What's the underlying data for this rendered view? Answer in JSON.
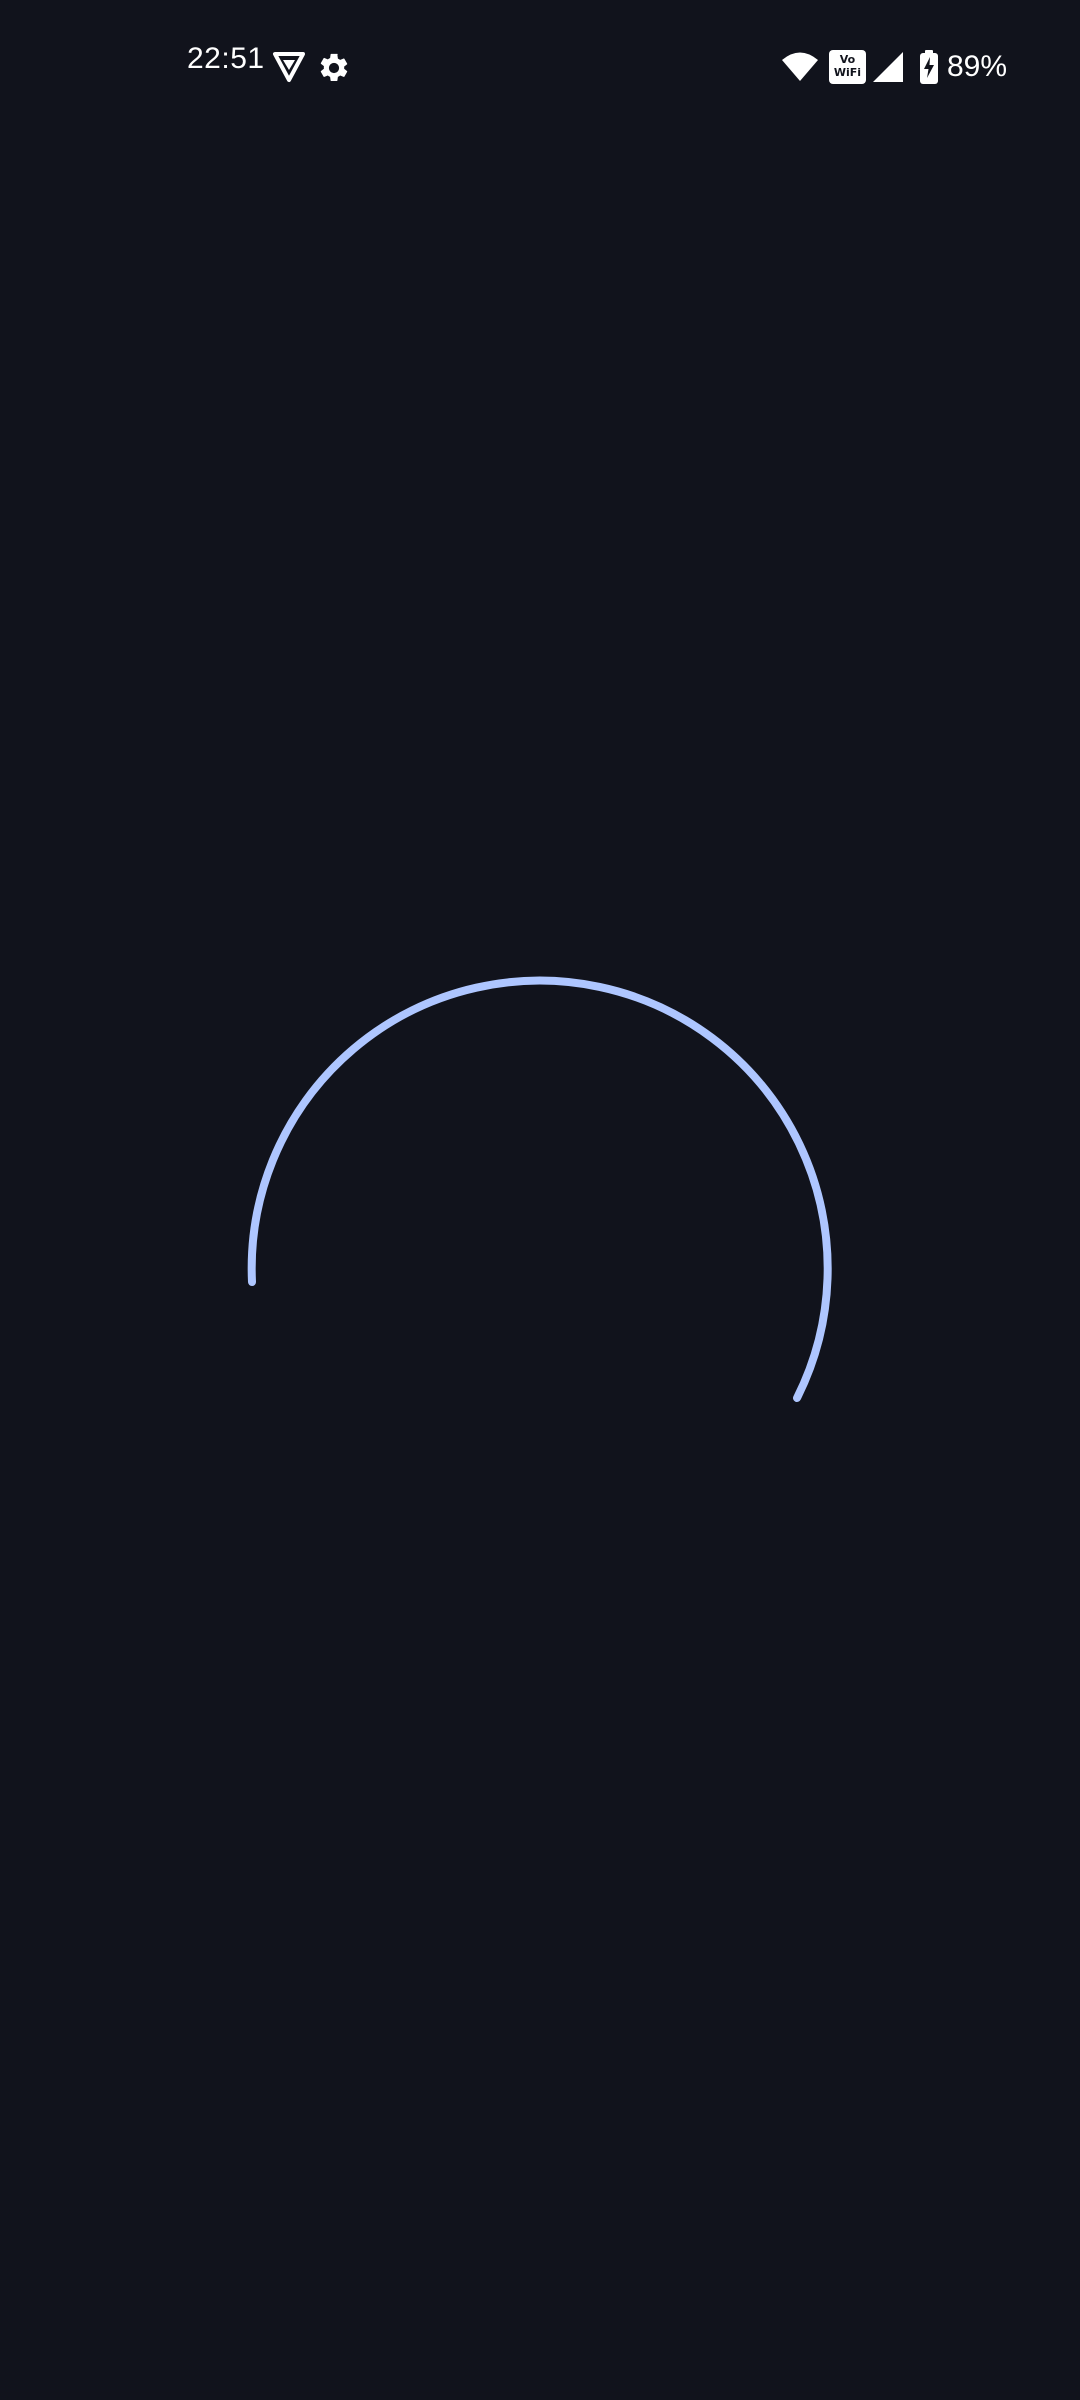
{
  "status_bar": {
    "time": "22:51",
    "notification_icons": [
      "vpn-shield-icon",
      "settings-gear-icon"
    ],
    "wifi_icon": "wifi-icon",
    "vowifi_label_top": "Vo",
    "vowifi_label_bottom": "WiFi",
    "signal_icon": "cellular-signal-icon",
    "battery_icon": "battery-charging-icon",
    "battery_percent": "89%"
  },
  "content": {
    "state": "loading",
    "indicator": "circular-progress-spinner",
    "colors": {
      "background": "#11131c",
      "spinner": "#aec6ff",
      "status_text": "#ffffff"
    }
  }
}
